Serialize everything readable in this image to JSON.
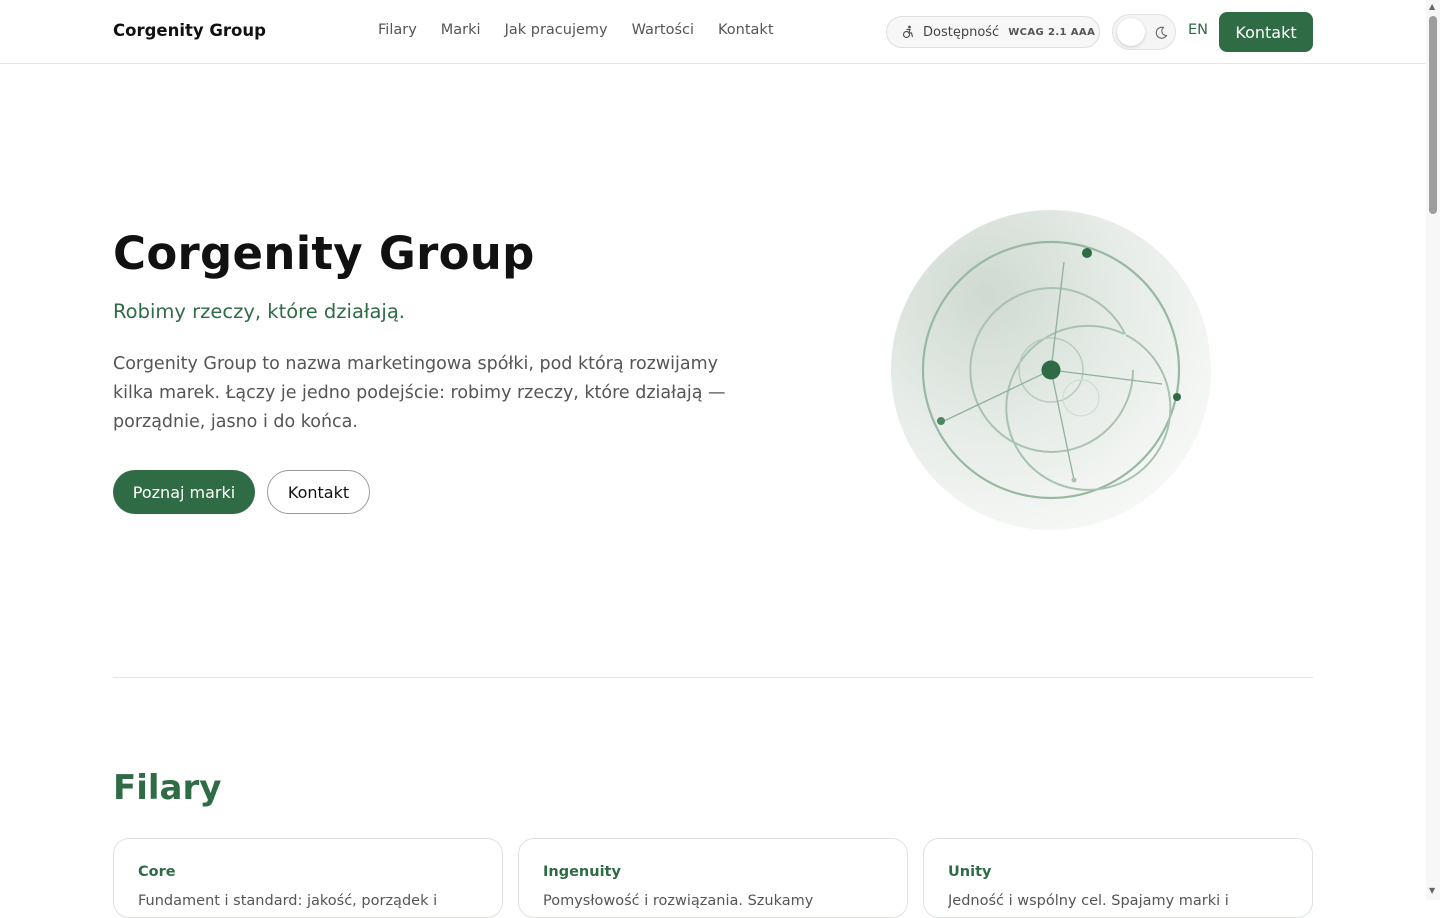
{
  "header": {
    "brand": "Corgenity Group",
    "nav": [
      "Filary",
      "Marki",
      "Jak pracujemy",
      "Wartości",
      "Kontakt"
    ],
    "accessibility": {
      "label": "Dostępność",
      "badge": "WCAG 2.1 AAA",
      "icon": "accessibility-icon"
    },
    "theme_toggle": {
      "state": "light",
      "icon": "moon-icon"
    },
    "lang": "EN",
    "contact_button": "Kontakt"
  },
  "hero": {
    "title": "Corgenity Group",
    "subtitle": "Robimy rzeczy, które działają.",
    "description": "Corgenity Group to nazwa marketingowa spółki, pod którą rozwijamy kilka marek. Łączy je jedno podejście: robimy rzeczy, które działają — porządnie, jasno i do końca.",
    "primary_button": "Poznaj marki",
    "secondary_button": "Kontakt"
  },
  "pillars": {
    "title": "Filary",
    "cards": [
      {
        "title": "Core",
        "body": "Fundament i standard: jakość, porządek i"
      },
      {
        "title": "Ingenuity",
        "body": "Pomysłowość i rozwiązania. Szukamy"
      },
      {
        "title": "Unity",
        "body": "Jedność i wspólny cel. Spajamy marki i"
      }
    ]
  },
  "colors": {
    "accent": "#2f6b45",
    "text": "#111111",
    "muted": "#555555",
    "border": "#dfe3df"
  }
}
